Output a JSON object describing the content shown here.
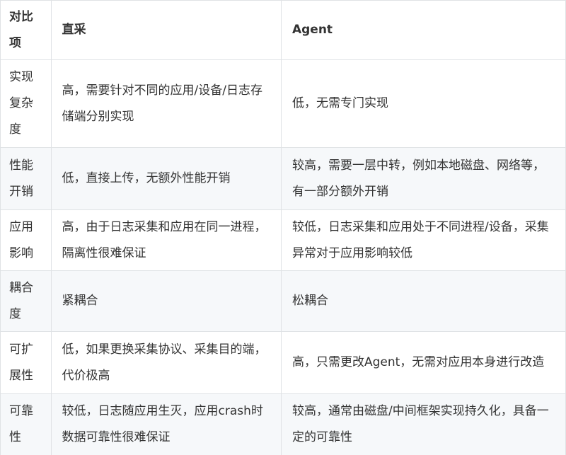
{
  "header": {
    "col1": "对比项",
    "col2": "直采",
    "col3": "Agent"
  },
  "rows": [
    {
      "item": "实现复杂度",
      "direct": "高，需要针对不同的应用/设备/日志存储端分别实现",
      "agent": "低，无需专门实现"
    },
    {
      "item": "性能开销",
      "direct": "低，直接上传，无额外性能开销",
      "agent": "较高，需要一层中转，例如本地磁盘、网络等，有一部分额外开销"
    },
    {
      "item": "应用影响",
      "direct": "高，由于日志采集和应用在同一进程，隔离性很难保证",
      "agent": "较低，日志采集和应用处于不同进程/设备，采集异常对于应用影响较低"
    },
    {
      "item": "耦合度",
      "direct": "紧耦合",
      "agent": "松耦合"
    },
    {
      "item": "可扩展性",
      "direct": "低，如果更换采集协议、采集目的端，代价极高",
      "agent": "高，只需更改Agent，无需对应用本身进行改造"
    },
    {
      "item": "可靠性",
      "direct": "较低，日志随应用生灭，应用crash时数据可靠性很难保证",
      "agent": "较高，通常由磁盘/中间框架实现持久化，具备一定的可靠性"
    }
  ],
  "colors": {
    "border": "#dfe2e5",
    "stripe": "#f6f8fa",
    "text": "#333333"
  }
}
